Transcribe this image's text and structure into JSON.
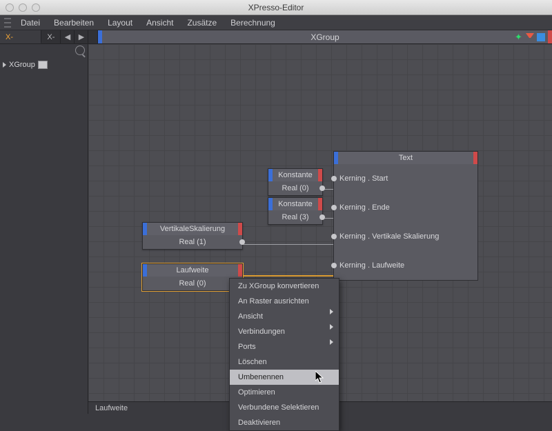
{
  "window": {
    "title": "XPresso-Editor"
  },
  "menu": {
    "items": [
      "Datei",
      "Bearbeiten",
      "Layout",
      "Ansicht",
      "Zusätze",
      "Berechnung"
    ]
  },
  "left": {
    "tabs": {
      "active": "X-Manager",
      "other": "X-P"
    },
    "tree": {
      "root": "XGroup"
    }
  },
  "canvas": {
    "header": "XGroup"
  },
  "nodes": {
    "vert": {
      "title": "VertikaleSkalierung",
      "value": "Real (1)"
    },
    "lauf": {
      "title": "Laufweite",
      "value": "Real (0)"
    },
    "k1": {
      "title": "Konstante",
      "value": "Real (0)"
    },
    "k2": {
      "title": "Konstante",
      "value": "Real (3)"
    },
    "text": {
      "title": "Text",
      "ports": [
        "Kerning . Start",
        "Kerning . Ende",
        "Kerning . Vertikale Skalierung",
        "Kerning . Laufweite"
      ]
    }
  },
  "context": {
    "items": [
      {
        "label": "Zu XGroup konvertieren",
        "sub": false
      },
      {
        "label": "An Raster ausrichten",
        "sub": false
      },
      {
        "label": "Ansicht",
        "sub": true
      },
      {
        "label": "Verbindungen",
        "sub": true
      },
      {
        "label": "Ports",
        "sub": true
      },
      {
        "label": "Löschen",
        "sub": false
      },
      {
        "label": "Umbenennen",
        "sub": false,
        "hover": true
      },
      {
        "label": "Optimieren",
        "sub": false
      },
      {
        "label": "Verbundene Selektieren",
        "sub": false
      },
      {
        "label": "Deaktivieren",
        "sub": false
      }
    ]
  },
  "status": {
    "text": "Laufweite"
  }
}
